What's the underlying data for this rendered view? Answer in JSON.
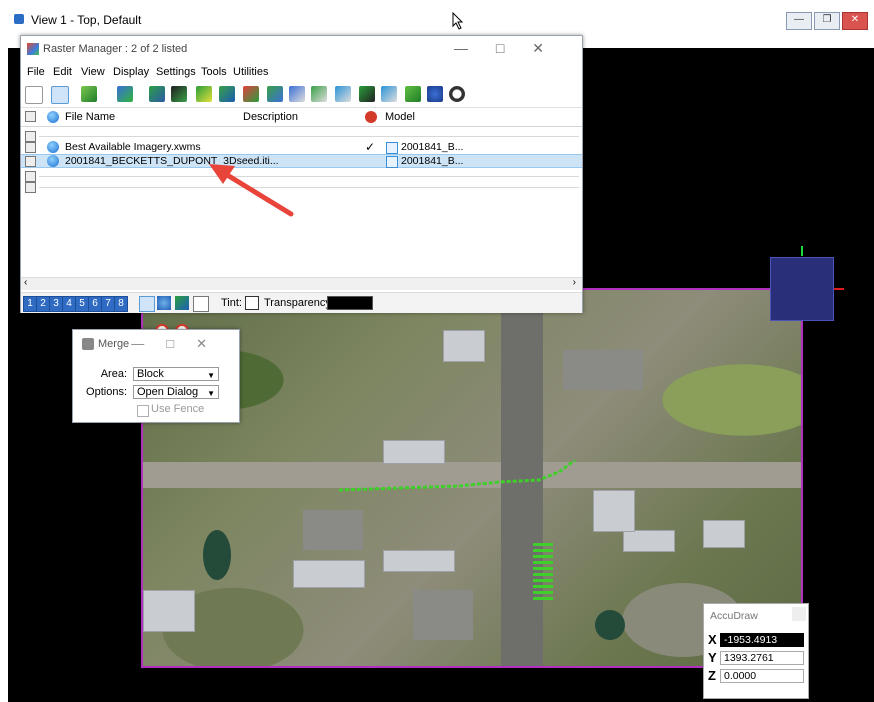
{
  "view_window": {
    "title": "View 1 - Top, Default",
    "controls": [
      "minimize",
      "restore",
      "close"
    ]
  },
  "raster_manager": {
    "title": "Raster Manager : 2 of 2 listed",
    "menu": [
      "File",
      "Edit",
      "View",
      "Display",
      "Settings",
      "Tools",
      "Utilities"
    ],
    "columns": {
      "file_name": "File Name",
      "description": "Description",
      "model": "Model"
    },
    "rows": [
      {
        "file_name": "Best Available Imagery.xwms",
        "description": "",
        "checked": "✓",
        "model": "2001841_B...",
        "selected": false
      },
      {
        "file_name": "2001841_BECKETTS_DUPONT_3Dseed.iti...",
        "description": "",
        "checked": "",
        "model": "2001841_B...",
        "selected": true
      }
    ],
    "view_numbers": [
      "1",
      "2",
      "3",
      "4",
      "5",
      "6",
      "7",
      "8"
    ],
    "tint_label": "Tint:",
    "transparency_label": "Transparency:"
  },
  "merge_dialog": {
    "title": "Merge",
    "area_label": "Area:",
    "area_value": "Block",
    "options_label": "Options:",
    "options_value": "Open Dialog",
    "use_fence_label": "Use Fence",
    "use_fence_checked": false
  },
  "accudraw": {
    "title": "AccuDraw",
    "x_label": "X",
    "x_value": "-1953.4913",
    "y_label": "Y",
    "y_value": "1393.2761",
    "z_label": "Z",
    "z_value": "0.0000"
  },
  "colors": {
    "selection_border": "#b030c0",
    "arrow": "#e8443a",
    "accent_blue": "#2f6bc3"
  }
}
